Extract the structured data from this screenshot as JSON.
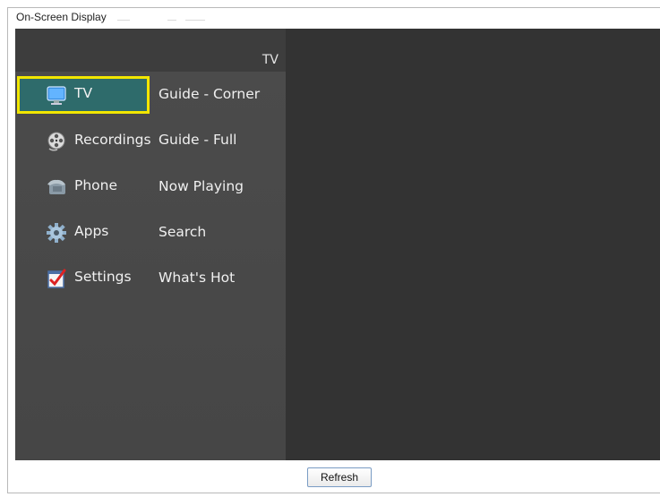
{
  "window": {
    "title": "On-Screen Display"
  },
  "osd": {
    "header": "TV",
    "menu_items": [
      {
        "label": "TV",
        "icon": "tv-icon",
        "selected": true
      },
      {
        "label": "Recordings",
        "icon": "film-reel-icon",
        "selected": false
      },
      {
        "label": "Phone",
        "icon": "phone-icon",
        "selected": false
      },
      {
        "label": "Apps",
        "icon": "gear-icon",
        "selected": false
      },
      {
        "label": "Settings",
        "icon": "checklist-icon",
        "selected": false
      }
    ],
    "submenu_items": [
      {
        "label": "Guide - Corner"
      },
      {
        "label": "Guide - Full"
      },
      {
        "label": "Now Playing"
      },
      {
        "label": "Search"
      },
      {
        "label": "What's Hot"
      }
    ],
    "colors": {
      "highlight_border": "#f2e600",
      "selected_bg": "#2e6b6b",
      "menu_bg": "#464646",
      "screen_bg": "#333333"
    }
  },
  "footer": {
    "refresh_label": "Refresh"
  }
}
